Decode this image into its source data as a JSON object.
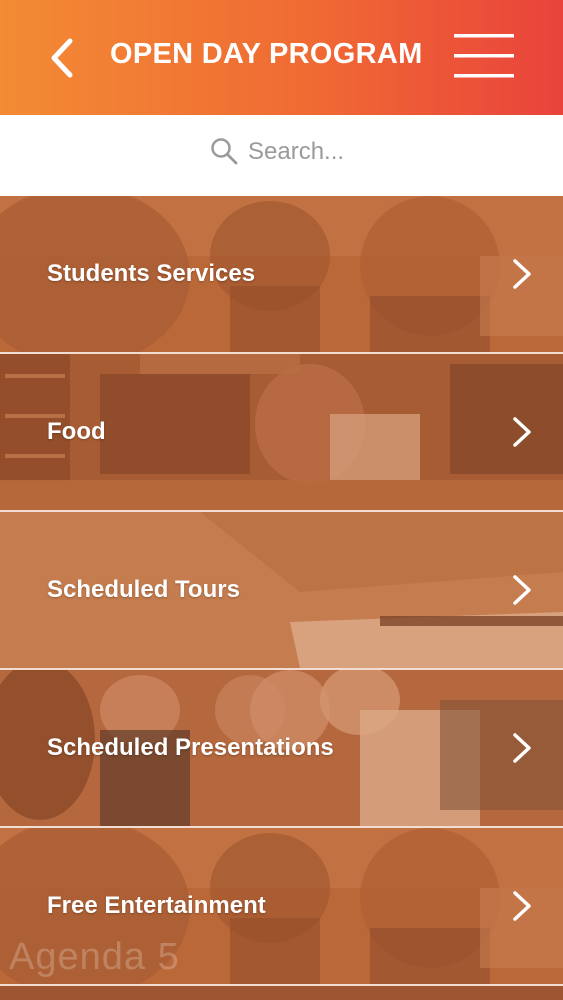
{
  "header": {
    "title": "OPEN DAY PROGRAM",
    "back_icon": "chevron-left-icon",
    "menu_icon": "hamburger-menu-icon"
  },
  "search": {
    "placeholder": "Search...",
    "value": "",
    "icon": "search-icon"
  },
  "menu_items": [
    {
      "label": "Students Services",
      "icon": "chevron-right-icon"
    },
    {
      "label": "Food",
      "icon": "chevron-right-icon"
    },
    {
      "label": "Scheduled Tours",
      "icon": "chevron-right-icon"
    },
    {
      "label": "Scheduled Presentations",
      "icon": "chevron-right-icon"
    },
    {
      "label": "Free Entertainment",
      "icon": "chevron-right-icon"
    }
  ],
  "watermark": "Agenda 5",
  "colors": {
    "header_gradient_start": "#f28b34",
    "header_gradient_end": "#e9433c",
    "tile_overlay": "#c06a3a",
    "label_text": "#ffffff",
    "search_text": "#9a9a9a"
  }
}
